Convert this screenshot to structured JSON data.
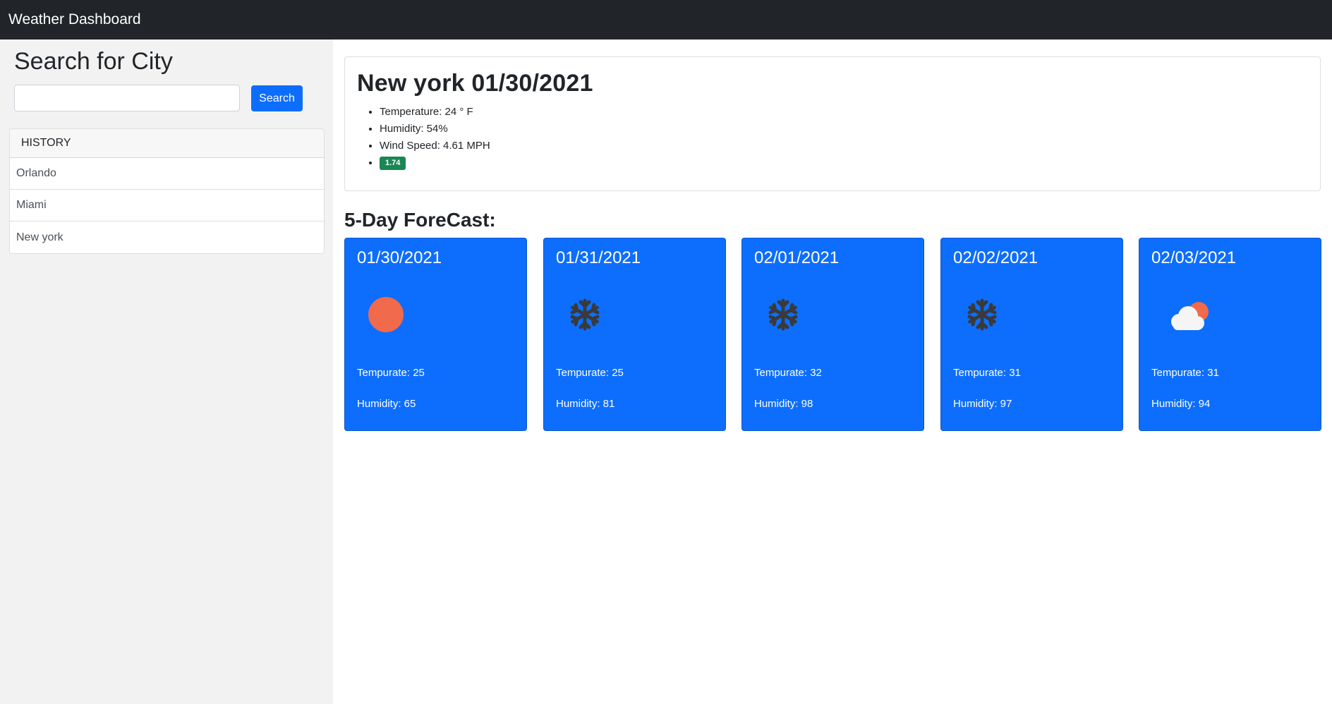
{
  "navbar": {
    "brand": "Weather Dashboard"
  },
  "sidebar": {
    "title": "Search for City",
    "search": {
      "value": "",
      "placeholder": ""
    },
    "search_button": "Search",
    "history_header": "HISTORY",
    "history": [
      "Orlando",
      "Miami",
      "New york"
    ]
  },
  "current": {
    "title": "New york 01/30/2021",
    "temperature": "Temperature: 24 ° F",
    "humidity": "Humidity: 54%",
    "wind": "Wind Speed: 4.61 MPH",
    "uv_index": "1.74",
    "uv_color": "#198754"
  },
  "forecast": {
    "heading": "5-Day ForeCast:",
    "days": [
      {
        "date": "01/30/2021",
        "icon": "sun-icon",
        "temp": "Tempurate: 25",
        "humidity": "Humidity: 65"
      },
      {
        "date": "01/31/2021",
        "icon": "snowflake-icon",
        "temp": "Tempurate: 25",
        "humidity": "Humidity: 81"
      },
      {
        "date": "02/01/2021",
        "icon": "snowflake-icon",
        "temp": "Tempurate: 32",
        "humidity": "Humidity: 98"
      },
      {
        "date": "02/02/2021",
        "icon": "snowflake-icon",
        "temp": "Tempurate: 31",
        "humidity": "Humidity: 97"
      },
      {
        "date": "02/03/2021",
        "icon": "cloud-sun-icon",
        "temp": "Tempurate: 31",
        "humidity": "Humidity: 94"
      }
    ]
  },
  "colors": {
    "navbar": "#212529",
    "sidebar": "#f2f2f2",
    "primary": "#0d6efd",
    "sun": "#f06a4b",
    "snow": "#3a3a3a"
  }
}
